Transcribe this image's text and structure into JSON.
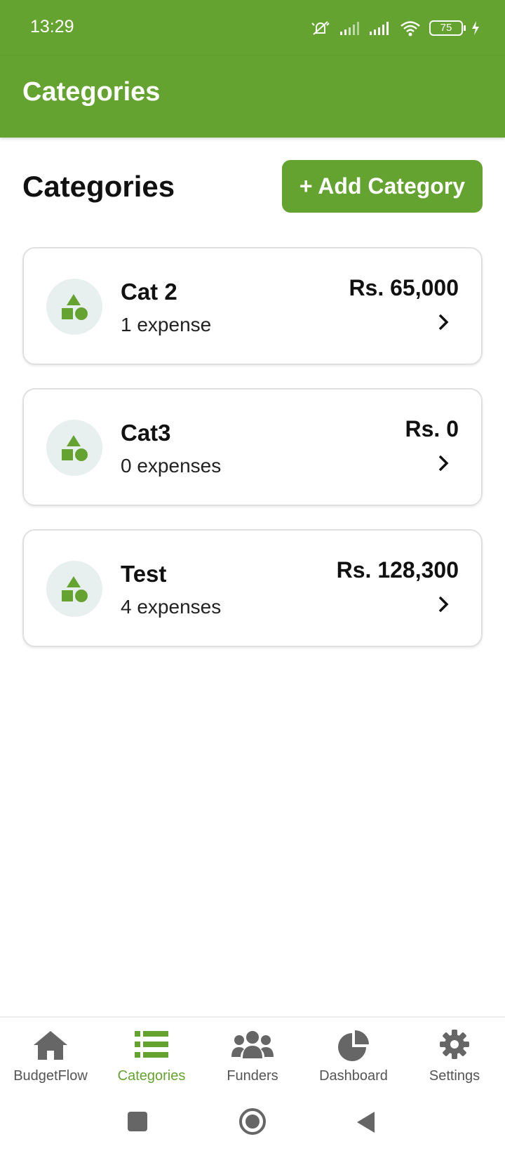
{
  "status_bar": {
    "time": "13:29",
    "battery": "75",
    "icons": [
      "mute-icon",
      "signal-icon",
      "signal-icon",
      "wifi-icon",
      "battery-icon",
      "charging-icon"
    ]
  },
  "app_bar": {
    "title": "Categories"
  },
  "main": {
    "section_title": "Categories",
    "add_button_label": "+ Add Category",
    "categories": [
      {
        "name": "Cat 2",
        "count": "1 expense",
        "amount": "Rs. 65,000"
      },
      {
        "name": "Cat3",
        "count": "0 expenses",
        "amount": "Rs. 0"
      },
      {
        "name": "Test",
        "count": "4 expenses",
        "amount": "Rs. 128,300"
      }
    ]
  },
  "bottom_nav": {
    "items": [
      {
        "label": "BudgetFlow",
        "icon": "home-icon"
      },
      {
        "label": "Categories",
        "icon": "list-icon",
        "active": true
      },
      {
        "label": "Funders",
        "icon": "users-icon"
      },
      {
        "label": "Dashboard",
        "icon": "pie-chart-icon"
      },
      {
        "label": "Settings",
        "icon": "gear-icon"
      }
    ]
  },
  "colors": {
    "brand": "#65a330",
    "icon_bg": "#e8f0ef",
    "inactive": "#555555"
  }
}
